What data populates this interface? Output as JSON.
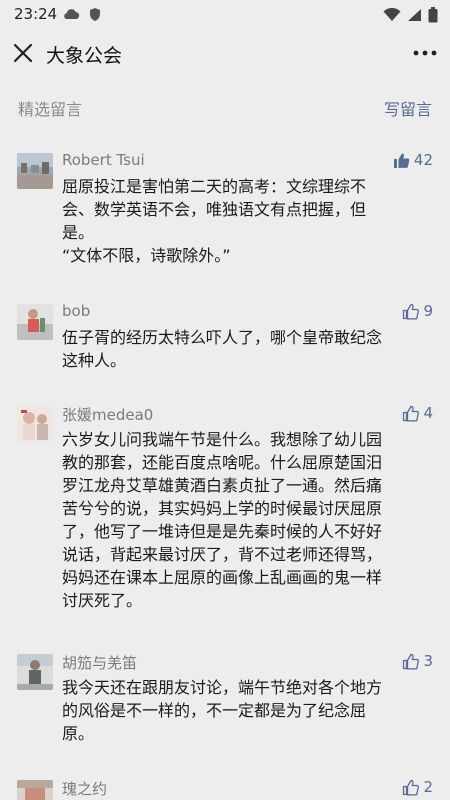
{
  "status_bar": {
    "time": "23:24",
    "left_icons": [
      "cloud-icon",
      "shield-icon"
    ],
    "right_icons": [
      "wifi-icon",
      "signal-icon",
      "battery-icon"
    ]
  },
  "nav": {
    "title": "大象公会",
    "close_icon": "close-icon",
    "more_icon": "more-icon"
  },
  "section": {
    "title": "精选留言",
    "write_label": "写留言"
  },
  "colors": {
    "background": "#ededed",
    "link": "#576b95",
    "name": "#7b7b7b",
    "text": "#1a1a1a"
  },
  "comments": [
    {
      "name": "Robert Tsui",
      "likes": "42",
      "liked": true,
      "lines": [
        "屈原投江是害怕第二天的高考：文综理综不",
        "会、数学英语不会，唯独语文有点把握，但",
        "是。",
        "“文体不限，诗歌除外。”"
      ]
    },
    {
      "name": "bob",
      "likes": "9",
      "liked": false,
      "lines": [
        "伍子胥的经历太特么吓人了，哪个皇帝敢纪念",
        "这种人。"
      ]
    },
    {
      "name": "张媛medea0",
      "likes": "4",
      "liked": false,
      "lines": [
        "六岁女儿问我端午节是什么。我想除了幼儿园",
        "教的那套，还能百度点啥呢。什么屈原楚国汨",
        "罗江龙舟艾草雄黄酒白素贞扯了一通。然后痛",
        "苦兮兮的说，其实妈妈上学的时候最讨厌屈原",
        "了，他写了一堆诗但是是先秦时候的人不好好",
        "说话，背起来最讨厌了，背不过老师还得骂，",
        "妈妈还在课本上屈原的画像上乱画画的鬼一样",
        "讨厌死了。"
      ]
    },
    {
      "name": "胡笳与羌笛",
      "likes": "3",
      "liked": false,
      "lines": [
        "我今天还在跟朋友讨论，端午节绝对各个地方",
        "的风俗是不一样的，不一定都是为了纪念屈",
        "原。"
      ]
    },
    {
      "name": "瑰之约",
      "likes": "2",
      "liked": false,
      "lines": []
    }
  ]
}
